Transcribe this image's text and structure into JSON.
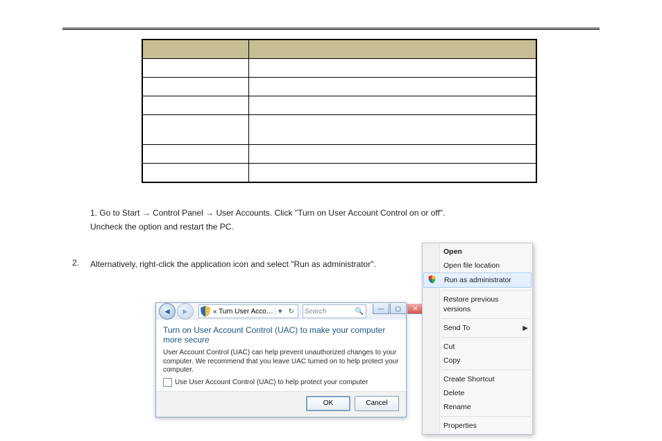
{
  "bodyText": {
    "line1_prefix": "1.  Go to Start ",
    "line1_mid": " Control Panel ",
    "line1_end": " User Accounts. Click \"Turn on User Account Control on or off\".",
    "line2": "Uncheck the option and restart the PC.",
    "line3_num": "2.",
    "line3": "Alternatively, right-click the application icon and select \"Run as administrator\"."
  },
  "uac": {
    "breadcrumb": "« Turn User Acco…",
    "search_placeholder": "Search",
    "heading": "Turn on User Account Control (UAC) to make your computer more secure",
    "desc": "User Account Control (UAC) can help prevent unauthorized changes to your computer. We recommend that you leave UAC turned on to help protect your computer.",
    "checkbox_label": "Use User Account Control (UAC) to help protect your computer",
    "ok": "OK",
    "cancel": "Cancel"
  },
  "menu": {
    "open": "Open",
    "openloc": "Open file location",
    "runadmin": "Run as administrator",
    "restore": "Restore previous versions",
    "sendto": "Send To",
    "cut": "Cut",
    "copy": "Copy",
    "shortcut": "Create Shortcut",
    "delete": "Delete",
    "rename": "Rename",
    "properties": "Properties"
  }
}
